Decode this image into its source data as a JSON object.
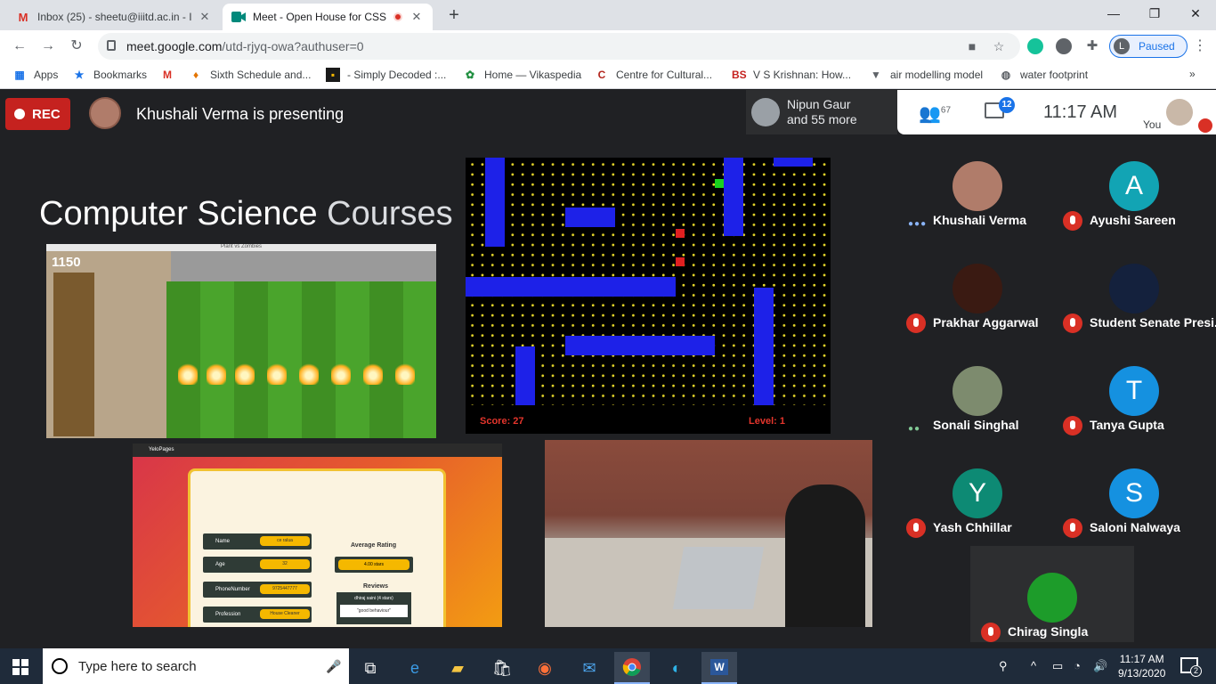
{
  "browser": {
    "tabs": [
      {
        "title": "Inbox (25) - sheetu@iiitd.ac.in - I",
        "icon": "gmail-icon",
        "active": false
      },
      {
        "title": "Meet - Open House for CSS",
        "icon": "meet-icon",
        "active": true
      }
    ],
    "url_host": "meet.google.com",
    "url_path": "/utd-rjyq-owa?authuser=0",
    "profile_initial": "L",
    "profile_label": "Paused",
    "bookmarks": [
      {
        "label": "Apps",
        "icon": "apps-grid-icon"
      },
      {
        "label": "Bookmarks",
        "icon": "star-icon"
      },
      {
        "label": "",
        "icon": "gmail-icon"
      },
      {
        "label": "Sixth Schedule and...",
        "icon": "bookmark-icon"
      },
      {
        "label": "- Simply Decoded :...",
        "icon": "bookmark-icon"
      },
      {
        "label": "Home — Vikaspedia",
        "icon": "bookmark-icon"
      },
      {
        "label": "Centre for Cultural...",
        "icon": "bookmark-icon"
      },
      {
        "label": "V S Krishnan: How...",
        "icon": "bs-icon"
      },
      {
        "label": "air modelling model",
        "icon": "bookmark-icon"
      },
      {
        "label": "water footprint",
        "icon": "globe-icon"
      }
    ],
    "more_bookmarks": "»",
    "colors": {
      "accent": "#1a73e8",
      "rec": "#c5221f"
    }
  },
  "meet": {
    "rec_label": "REC",
    "presenting_text": "Khushali Verma is presenting",
    "pinned_line1": "Nipun Gaur",
    "pinned_line2": "and 55 more",
    "people_count": "67",
    "chat_badge": "12",
    "clock": "11:17  AM",
    "you_label": "You",
    "participants": [
      {
        "name": "Khushali Verma",
        "initial": "",
        "color": "#b07c6a",
        "state": "talking"
      },
      {
        "name": "Ayushi Sareen",
        "initial": "A",
        "color": "#12a4b4",
        "state": "muted"
      },
      {
        "name": "Prakhar Aggarwal",
        "initial": "",
        "color": "#3a1a12",
        "state": "muted"
      },
      {
        "name": "Student Senate Presi...",
        "initial": "",
        "color": "#14213d",
        "state": "muted"
      },
      {
        "name": "Sonali Singhal",
        "initial": "",
        "color": "#7d8b6e",
        "state": "talking"
      },
      {
        "name": "Tanya Gupta",
        "initial": "T",
        "color": "#1591e0",
        "state": "muted"
      },
      {
        "name": "Yash Chhillar",
        "initial": "Y",
        "color": "#0d8a74",
        "state": "muted"
      },
      {
        "name": "Saloni Nalwaya",
        "initial": "S",
        "color": "#1591e0",
        "state": "muted"
      },
      {
        "name": "Chirag Singla",
        "initial": "",
        "color": "#1d9c2a",
        "state": "muted"
      }
    ]
  },
  "slide": {
    "title_bold": "Computer Science",
    "title_light": "Courses",
    "pvz_window_title": "Plant vs Zombies",
    "pvz_sun": "1150",
    "maze_score": "Score: 27",
    "maze_level": "Level: 1",
    "yelo_brand": "YeloPages",
    "yelo_fields": [
      {
        "label": "Name",
        "value": "ce ralua"
      },
      {
        "label": "Age",
        "value": "32"
      },
      {
        "label": "PhoneNumber",
        "value": "9725447777"
      },
      {
        "label": "Profession",
        "value": "House Cleaner"
      }
    ],
    "avg_rating_label": "Average Rating",
    "avg_rating_value": "4.00 stars",
    "reviews_label": "Reviews",
    "review_author": "dhiraj saini (4 stars)",
    "review_text": "\"good behaviour\""
  },
  "taskbar": {
    "search_placeholder": "Type here to search",
    "time": "11:17 AM",
    "date": "9/13/2020",
    "notifications": "2"
  }
}
